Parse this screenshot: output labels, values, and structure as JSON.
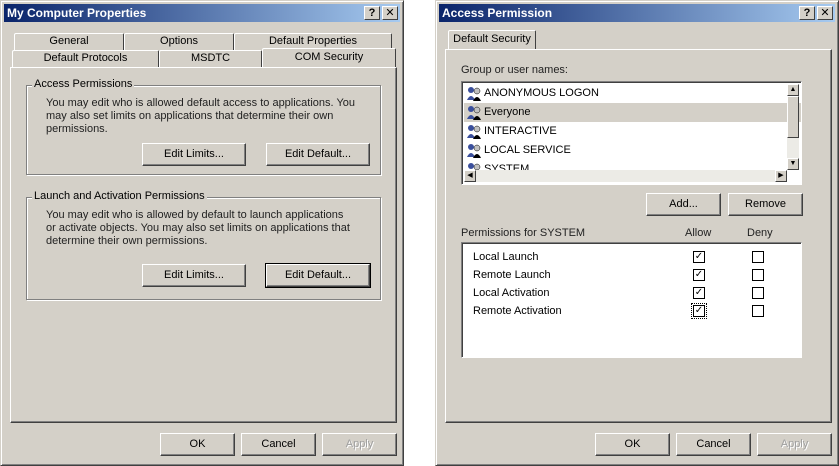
{
  "left_dialog": {
    "title": "My Computer Properties",
    "help_glyph": "?",
    "close_glyph": "✕",
    "tabs_row1": [
      "General",
      "Options",
      "Default Properties"
    ],
    "tabs_row2": [
      "Default Protocols",
      "MSDTC",
      "COM Security"
    ],
    "active_tab": "COM Security",
    "access_permissions": {
      "label": "Access Permissions",
      "text": "You may edit who is allowed default access to applications. You may also set limits on applications that determine their own permissions.",
      "edit_limits": "Edit Limits...",
      "edit_default": "Edit Default..."
    },
    "launch_permissions": {
      "label": "Launch and Activation Permissions",
      "text": "You may edit who is allowed by default to launch applications or activate objects. You may also set limits on applications that determine their own permissions.",
      "edit_limits": "Edit Limits...",
      "edit_default": "Edit Default..."
    },
    "footer": {
      "ok": "OK",
      "cancel": "Cancel",
      "apply": "Apply"
    }
  },
  "right_dialog": {
    "title": "Access Permission",
    "help_glyph": "?",
    "close_glyph": "✕",
    "tab": "Default Security",
    "group_label": "Group or user names:",
    "users": [
      {
        "name": "ANONYMOUS LOGON",
        "selected": false
      },
      {
        "name": "Everyone",
        "selected": true
      },
      {
        "name": "INTERACTIVE",
        "selected": false
      },
      {
        "name": "LOCAL SERVICE",
        "selected": false
      },
      {
        "name": "SYSTEM",
        "selected": false
      }
    ],
    "add_button": "Add...",
    "remove_button": "Remove",
    "permissions_label": "Permissions for SYSTEM",
    "allow_header": "Allow",
    "deny_header": "Deny",
    "permissions": [
      {
        "name": "Local Launch",
        "allow": true,
        "deny": false
      },
      {
        "name": "Remote Launch",
        "allow": true,
        "deny": false
      },
      {
        "name": "Local Activation",
        "allow": true,
        "deny": false
      },
      {
        "name": "Remote Activation",
        "allow": true,
        "deny": false
      }
    ],
    "footer": {
      "ok": "OK",
      "cancel": "Cancel",
      "apply": "Apply"
    }
  },
  "colors": {
    "title_start": "#0a246a",
    "title_end": "#a6caf0",
    "face": "#d4d0c8"
  }
}
